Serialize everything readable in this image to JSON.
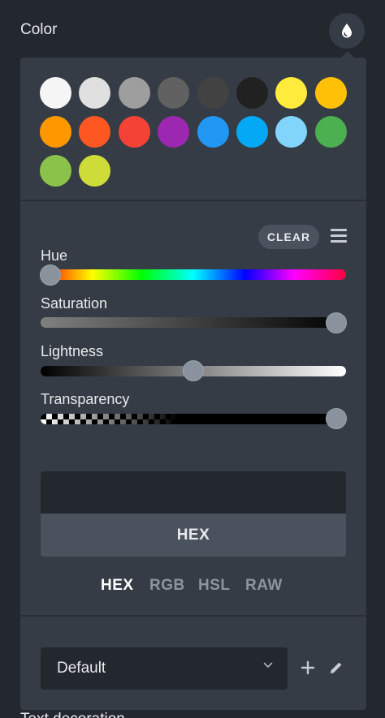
{
  "header": {
    "label": "Color",
    "icon": "drop-icon"
  },
  "swatches": [
    "#f5f5f5",
    "#e0e0e0",
    "#9e9e9e",
    "#616161",
    "#424242",
    "#212121",
    "#ffeb3b",
    "#ffc107",
    "#ff9800",
    "#ff5722",
    "#f44336",
    "#9c27b0",
    "#2196f3",
    "#03a9f4",
    "#81d4fa",
    "#4caf50",
    "#8bc34a",
    "#cddc39"
  ],
  "toolbar": {
    "clear_label": "CLEAR",
    "menu_icon": "hamburger-icon"
  },
  "sliders": {
    "hue": {
      "label": "Hue",
      "value": 0
    },
    "saturation": {
      "label": "Saturation",
      "value": 1
    },
    "lightness": {
      "label": "Lightness",
      "value": 0.5
    },
    "transparency": {
      "label": "Transparency",
      "value": 1
    }
  },
  "hex_field": {
    "label": "HEX"
  },
  "modes": [
    {
      "label": "HEX",
      "active": true
    },
    {
      "label": "RGB",
      "active": false
    },
    {
      "label": "HSL",
      "active": false
    },
    {
      "label": "RAW",
      "active": false
    }
  ],
  "palette": {
    "selected": "Default"
  },
  "footer": {
    "label": "Text decoration"
  },
  "colors": {
    "panel": "#363c45",
    "background": "#23272e",
    "active_tab": "#ffffff",
    "inactive_tab": "#8d949c"
  }
}
